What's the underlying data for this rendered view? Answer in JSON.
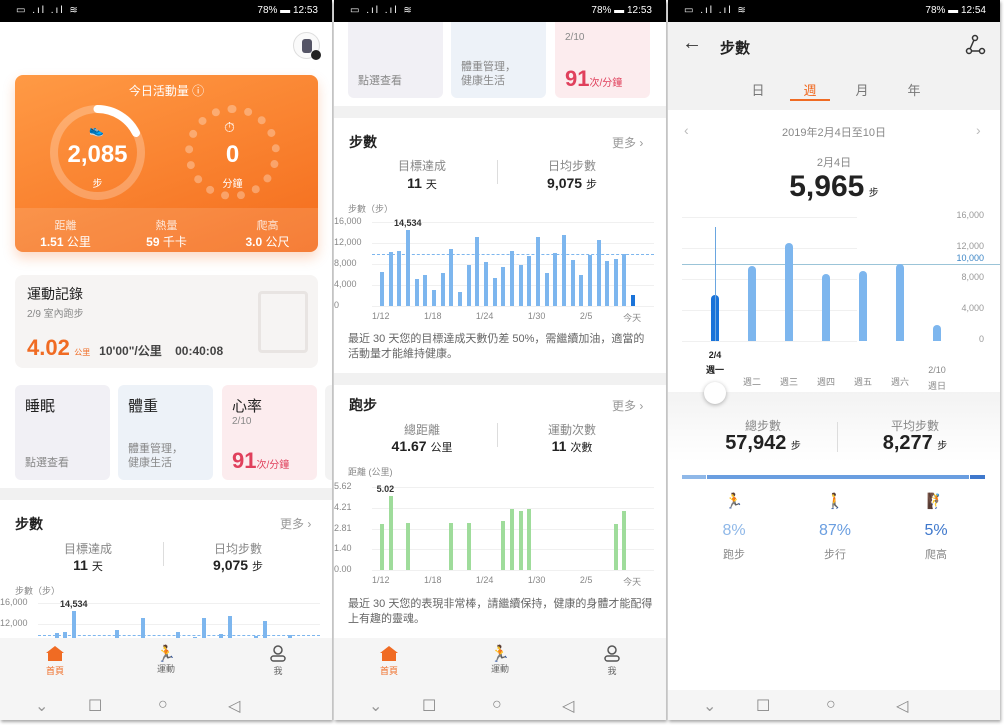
{
  "colors": {
    "orange": "#f47a2a",
    "bar_blue": "#7db6ee",
    "bar_today": "#1a73d9",
    "run_green": "#9fdc9b",
    "heart": "#e0405c",
    "accent_tab": "#f06b23"
  },
  "status_bars": [
    {
      "time": "12:53",
      "battery": "78%"
    },
    {
      "time": "12:53",
      "battery": "78%"
    },
    {
      "time": "12:54",
      "battery": "78%"
    }
  ],
  "home": {
    "activity": {
      "title": "今日活動量",
      "steps": "2,085",
      "steps_unit": "步",
      "minutes": "0",
      "minutes_unit": "分鐘",
      "goal_progress": 0.21,
      "stats": [
        {
          "label": "距離",
          "value": "1.51",
          "unit": "公里"
        },
        {
          "label": "熱量",
          "value": "59",
          "unit": "千卡"
        },
        {
          "label": "爬高",
          "value": "3.0",
          "unit": "公尺"
        }
      ]
    },
    "exercise": {
      "title": "運動記錄",
      "subtitle": "2/9  室內跑步",
      "distance": "4.02",
      "distance_unit": "公里",
      "pace": "10'00\"/公里",
      "duration": "00:40:08"
    },
    "cards": {
      "sleep": {
        "title": "睡眠",
        "sub": "點選查看"
      },
      "weight": {
        "title": "體重",
        "sub1": "體重管理，",
        "sub2": "健康生活"
      },
      "heart": {
        "title": "心率",
        "date": "2/10",
        "value": "91",
        "unit": "次/分鐘"
      }
    }
  },
  "steps_card": {
    "title": "步數",
    "more": "更多",
    "goal_label": "目標達成",
    "goal_value": "11",
    "goal_unit": "天",
    "avg_label": "日均步數",
    "avg_value": "9,075",
    "avg_unit": "步",
    "axis_title": "步數（步）",
    "note": "最近 30 天您的目標達成天數仍差 50%，需繼續加油，適當的活動量才能維持健康。"
  },
  "running_card": {
    "title": "跑步",
    "more": "更多",
    "dist_label": "總距離",
    "dist_value": "41.67",
    "dist_unit": "公里",
    "count_label": "運動次數",
    "count_value": "11",
    "count_unit": "次數",
    "axis_title": "距離 (公里)",
    "note": "最近 30 天您的表現非常棒，請繼續保持，健康的身體才能配得上有趣的靈魂。"
  },
  "bottom_nav": [
    {
      "label": "首頁",
      "icon": "home-icon",
      "active": true
    },
    {
      "label": "運動",
      "icon": "running-icon"
    },
    {
      "label": "我",
      "icon": "user-icon"
    }
  ],
  "detail": {
    "title": "步數",
    "tabs": [
      "日",
      "週",
      "月",
      "年"
    ],
    "active_tab": "週",
    "range": "2019年2月4日至10日",
    "selected_date": "2月4日",
    "selected_value": "5,965",
    "unit": "步",
    "total_label": "總步數",
    "total_value": "57,942",
    "avg_label": "平均步數",
    "avg_value": "8,277",
    "breakdown": [
      {
        "pct": "8%",
        "label": "跑步",
        "icon": "running-icon",
        "color": "#8fb8e8"
      },
      {
        "pct": "87%",
        "label": "步行",
        "icon": "walking-icon",
        "color": "#6a9ee0"
      },
      {
        "pct": "5%",
        "label": "爬高",
        "icon": "climbing-icon",
        "color": "#3f78cc"
      }
    ]
  },
  "chart_data": [
    {
      "type": "bar",
      "title": "",
      "ylabel": "步數（步）",
      "ylim": [
        0,
        16000
      ],
      "yticks": [
        "16,000",
        "12,000",
        "8,000",
        "4,000",
        "0"
      ],
      "goal_line": 10000,
      "x": [
        "1/12",
        "1/13",
        "1/14",
        "1/15",
        "1/16",
        "1/17",
        "1/18",
        "1/19",
        "1/20",
        "1/21",
        "1/22",
        "1/23",
        "1/24",
        "1/25",
        "1/26",
        "1/27",
        "1/28",
        "1/29",
        "1/30",
        "1/31",
        "2/1",
        "2/2",
        "2/3",
        "2/4",
        "2/5",
        "2/6",
        "2/7",
        "2/8",
        "2/9",
        "今天"
      ],
      "xtick_labels": [
        "1/12",
        "1/18",
        "1/24",
        "1/30",
        "2/5",
        "今天"
      ],
      "values": [
        6500,
        10250,
        10400,
        14534,
        5200,
        6000,
        3000,
        6200,
        10800,
        2600,
        7900,
        13100,
        8400,
        5300,
        7400,
        10500,
        7900,
        9600,
        13100,
        6300,
        10100,
        13500,
        8700,
        5965,
        9700,
        12600,
        8600,
        9000,
        9992,
        2085
      ],
      "max_label": "14,534"
    },
    {
      "type": "bar",
      "title": "",
      "ylabel": "距離 (公里)",
      "ylim": [
        0,
        5.62
      ],
      "yticks": [
        "5.62",
        "4.21",
        "2.81",
        "1.40",
        "0.00"
      ],
      "xtick_labels": [
        "1/12",
        "1/18",
        "1/24",
        "1/30",
        "2/5",
        "今天"
      ],
      "x": [
        "1/12",
        "1/13",
        "1/15",
        "1/20",
        "1/22",
        "1/26",
        "1/27",
        "1/28",
        "1/29",
        "2/8",
        "2/9"
      ],
      "values": [
        3.1,
        5.02,
        3.2,
        3.2,
        3.2,
        3.3,
        4.1,
        4.0,
        4.1,
        3.1,
        4.02
      ],
      "max_label": "5.02"
    },
    {
      "type": "bar",
      "title": "",
      "ylim": [
        0,
        16000
      ],
      "yticks": [
        "16,000",
        "12,000",
        "10,000",
        "8,000",
        "4,000",
        "0"
      ],
      "goal_line": 10000,
      "categories": [
        "週一",
        "週二",
        "週三",
        "週四",
        "週五",
        "週六",
        "週日"
      ],
      "first_date": "2/4",
      "last_date": "2/10",
      "values": [
        5965,
        9700,
        12600,
        8600,
        9000,
        9992,
        2085
      ],
      "selected": "週一"
    }
  ]
}
